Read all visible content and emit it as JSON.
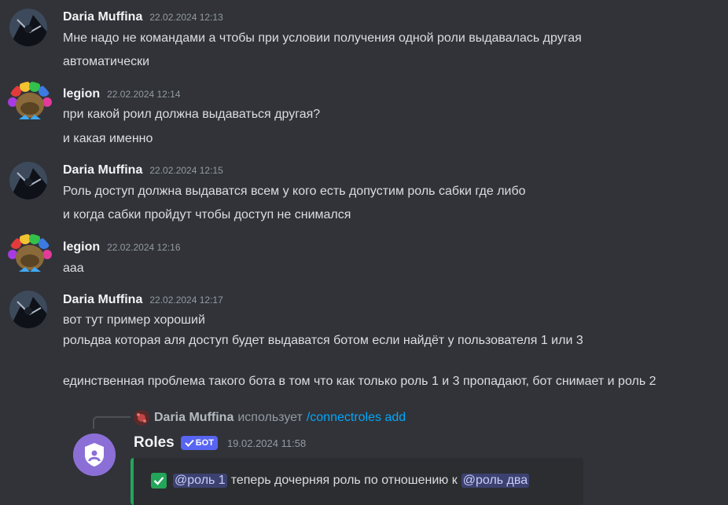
{
  "messages": [
    {
      "username": "Daria Muffina",
      "timestamp": "22.02.2024 12:13",
      "lines": [
        "Мне надо не командами а чтобы при условии получения одной роли выдавалась другая",
        "автоматически"
      ]
    },
    {
      "username": "legion",
      "timestamp": "22.02.2024 12:14",
      "lines": [
        "при какой роил должна выдаваться другая?",
        "и какая именно"
      ]
    },
    {
      "username": "Daria Muffina",
      "timestamp": "22.02.2024 12:15",
      "lines": [
        "Роль доступ должна выдаватся всем у кого есть допустим роль сабки где либо",
        "и когда сабки пройдут чтобы доступ не снимался"
      ]
    },
    {
      "username": "legion",
      "timestamp": "22.02.2024 12:16",
      "lines": [
        "ааа"
      ]
    },
    {
      "username": "Daria Muffina",
      "timestamp": "22.02.2024 12:17",
      "lines": [
        "вот тут пример хороший",
        "рольдва которая аля доступ будет выдаватся ботом если найдёт у пользователя 1 или 3",
        "единственная проблема такого бота в том что как только роль 1 и 3 пропадают, бот снимает и роль 2"
      ]
    }
  ],
  "reply": {
    "username": "Daria Muffina",
    "uses_text": "использует",
    "command": "/connectroles add"
  },
  "bot_message": {
    "username": "Roles",
    "badge": "БОТ",
    "timestamp": "19.02.2024 11:58",
    "embed": {
      "mention1": "@роль 1",
      "text": "теперь дочерняя роль по отношению к",
      "mention2": "@роль два",
      "accent": "#23a55a"
    }
  },
  "colors": {
    "background": "#313338",
    "username": "#f2f3f5",
    "timestamp": "#949ba4",
    "command": "#00a8fc",
    "bot_badge": "#5865f2"
  }
}
